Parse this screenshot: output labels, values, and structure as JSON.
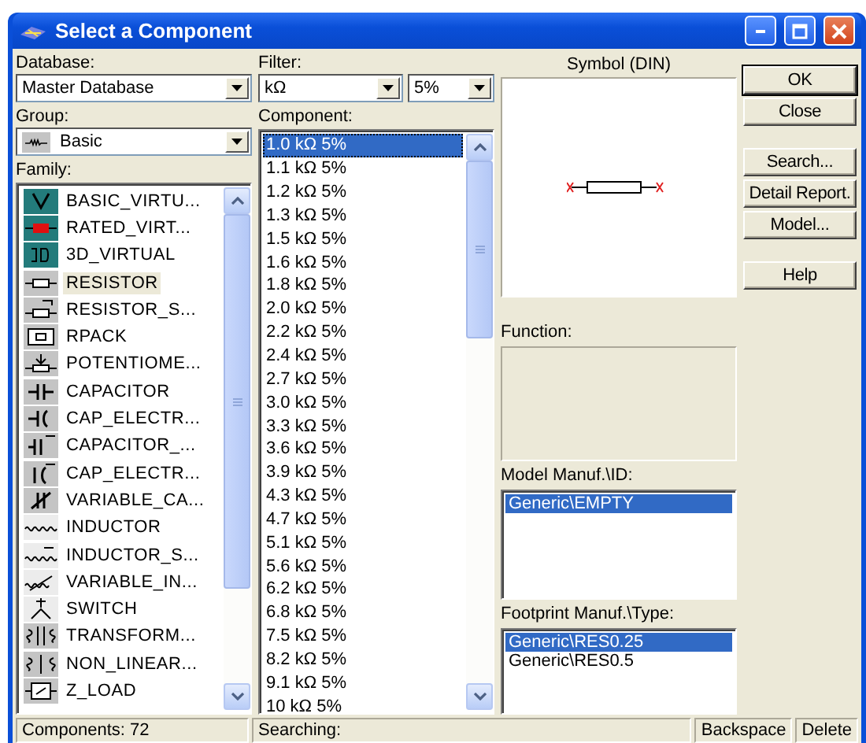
{
  "window": {
    "title": "Select a Component"
  },
  "database": {
    "label": "Database:",
    "value": "Master Database"
  },
  "group": {
    "label": "Group:",
    "value": "Basic"
  },
  "family": {
    "label": "Family:",
    "items": [
      {
        "label": "BASIC_VIRTU...",
        "color": "#237b7b",
        "selected": false
      },
      {
        "label": "RATED_VIRT...",
        "color": "#237b7b",
        "selected": false
      },
      {
        "label": "3D_VIRTUAL",
        "color": "#237b7b",
        "selected": false
      },
      {
        "label": "RESISTOR",
        "color": "#c4c4c4",
        "selected": true
      },
      {
        "label": "RESISTOR_S...",
        "color": "#c4c4c4",
        "selected": false
      },
      {
        "label": "RPACK",
        "color": "#c4c4c4",
        "selected": false
      },
      {
        "label": "POTENTIOME...",
        "color": "#c4c4c4",
        "selected": false
      },
      {
        "label": "CAPACITOR",
        "color": "#c4c4c4",
        "selected": false
      },
      {
        "label": "CAP_ELECTR...",
        "color": "#c4c4c4",
        "selected": false
      },
      {
        "label": "CAPACITOR_...",
        "color": "#c4c4c4",
        "selected": false
      },
      {
        "label": "CAP_ELECTR...",
        "color": "#c4c4c4",
        "selected": false
      },
      {
        "label": "VARIABLE_CA...",
        "color": "#c4c4c4",
        "selected": false
      },
      {
        "label": "INDUCTOR",
        "color": "#ececec",
        "selected": false
      },
      {
        "label": "INDUCTOR_S...",
        "color": "#ececec",
        "selected": false
      },
      {
        "label": "VARIABLE_IN...",
        "color": "#ececec",
        "selected": false
      },
      {
        "label": "SWITCH",
        "color": "#ececec",
        "selected": false
      },
      {
        "label": "TRANSFORM...",
        "color": "#c4c4c4",
        "selected": false
      },
      {
        "label": "NON_LINEAR...",
        "color": "#c4c4c4",
        "selected": false
      },
      {
        "label": "Z_LOAD",
        "color": "#c4c4c4",
        "selected": false
      }
    ]
  },
  "filter": {
    "label": "Filter:",
    "unit": "kΩ",
    "tolerance": "5%"
  },
  "component": {
    "label": "Component:",
    "items": [
      {
        "label": "1.0 kΩ 5%",
        "selected": true
      },
      {
        "label": "1.1 kΩ 5%",
        "selected": false
      },
      {
        "label": "1.2 kΩ 5%",
        "selected": false
      },
      {
        "label": "1.3 kΩ 5%",
        "selected": false
      },
      {
        "label": "1.5 kΩ 5%",
        "selected": false
      },
      {
        "label": "1.6 kΩ 5%",
        "selected": false
      },
      {
        "label": "1.8 kΩ 5%",
        "selected": false
      },
      {
        "label": "2.0 kΩ 5%",
        "selected": false
      },
      {
        "label": "2.2 kΩ 5%",
        "selected": false
      },
      {
        "label": "2.4 kΩ 5%",
        "selected": false
      },
      {
        "label": "2.7 kΩ 5%",
        "selected": false
      },
      {
        "label": "3.0 kΩ 5%",
        "selected": false
      },
      {
        "label": "3.3 kΩ 5%",
        "selected": false
      },
      {
        "label": "3.6 kΩ 5%",
        "selected": false
      },
      {
        "label": "3.9 kΩ 5%",
        "selected": false
      },
      {
        "label": "4.3 kΩ 5%",
        "selected": false
      },
      {
        "label": "4.7 kΩ 5%",
        "selected": false
      },
      {
        "label": "5.1 kΩ 5%",
        "selected": false
      },
      {
        "label": "5.6 kΩ 5%",
        "selected": false
      },
      {
        "label": "6.2 kΩ 5%",
        "selected": false
      },
      {
        "label": "6.8 kΩ 5%",
        "selected": false
      },
      {
        "label": "7.5 kΩ 5%",
        "selected": false
      },
      {
        "label": "8.2 kΩ 5%",
        "selected": false
      },
      {
        "label": "9.1 kΩ 5%",
        "selected": false
      },
      {
        "label": "10 kΩ 5%",
        "selected": false
      }
    ]
  },
  "symbol": {
    "label": "Symbol (DIN)"
  },
  "function": {
    "label": "Function:"
  },
  "model": {
    "label": "Model Manuf.\\ID:",
    "items": [
      {
        "label": "Generic\\EMPTY",
        "selected": true
      }
    ]
  },
  "footprint": {
    "label": "Footprint Manuf.\\Type:",
    "items": [
      {
        "label": "Generic\\RES0.25",
        "selected": true
      },
      {
        "label": "Generic\\RES0.5",
        "selected": false
      }
    ]
  },
  "buttons": [
    {
      "label": "OK",
      "default": true
    },
    {
      "label": "Close",
      "default": false
    },
    {
      "label": "Search...",
      "default": false
    },
    {
      "label": "Detail Report.",
      "default": false
    },
    {
      "label": "Model...",
      "default": false
    },
    {
      "label": "Help",
      "default": false
    }
  ],
  "status_bar": {
    "count": "Components: 72",
    "search": "Searching:",
    "keys": [
      "Backspace",
      "Delete"
    ]
  }
}
